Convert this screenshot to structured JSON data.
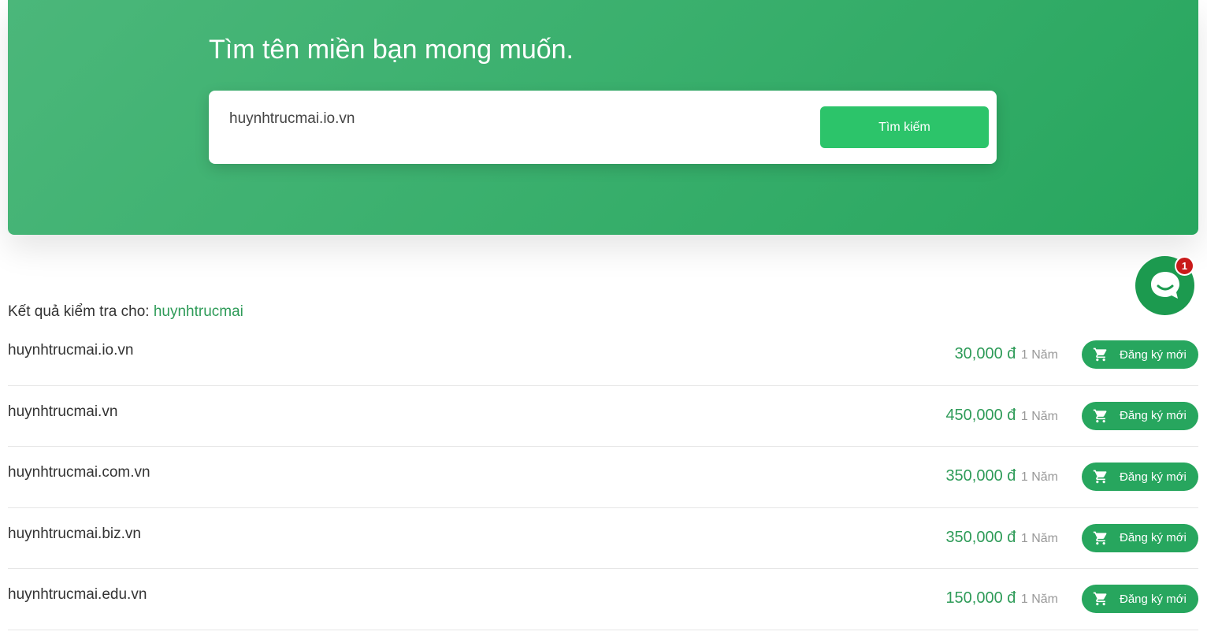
{
  "hero": {
    "title": "Tìm tên miền bạn mong muốn.",
    "search_value": "huynhtrucmai.io.vn",
    "search_button": "Tìm kiếm"
  },
  "results": {
    "heading_prefix": "Kết quả kiểm tra cho:",
    "keyword": "huynhtrucmai",
    "register_label": "Đăng ký mới",
    "items": [
      {
        "domain": "huynhtrucmai.io.vn",
        "price": "30,000 đ",
        "period": "1 Năm"
      },
      {
        "domain": "huynhtrucmai.vn",
        "price": "450,000 đ",
        "period": "1 Năm"
      },
      {
        "domain": "huynhtrucmai.com.vn",
        "price": "350,000 đ",
        "period": "1 Năm"
      },
      {
        "domain": "huynhtrucmai.biz.vn",
        "price": "350,000 đ",
        "period": "1 Năm"
      },
      {
        "domain": "huynhtrucmai.edu.vn",
        "price": "150,000 đ",
        "period": "1 Năm"
      }
    ]
  },
  "chat": {
    "icon": "chat-icon",
    "badge_count": "1"
  },
  "colors": {
    "brand_green": "#27a65e",
    "button_green": "#2cc46a",
    "price_green": "#2e9b58",
    "badge_red": "#c91a1a"
  }
}
